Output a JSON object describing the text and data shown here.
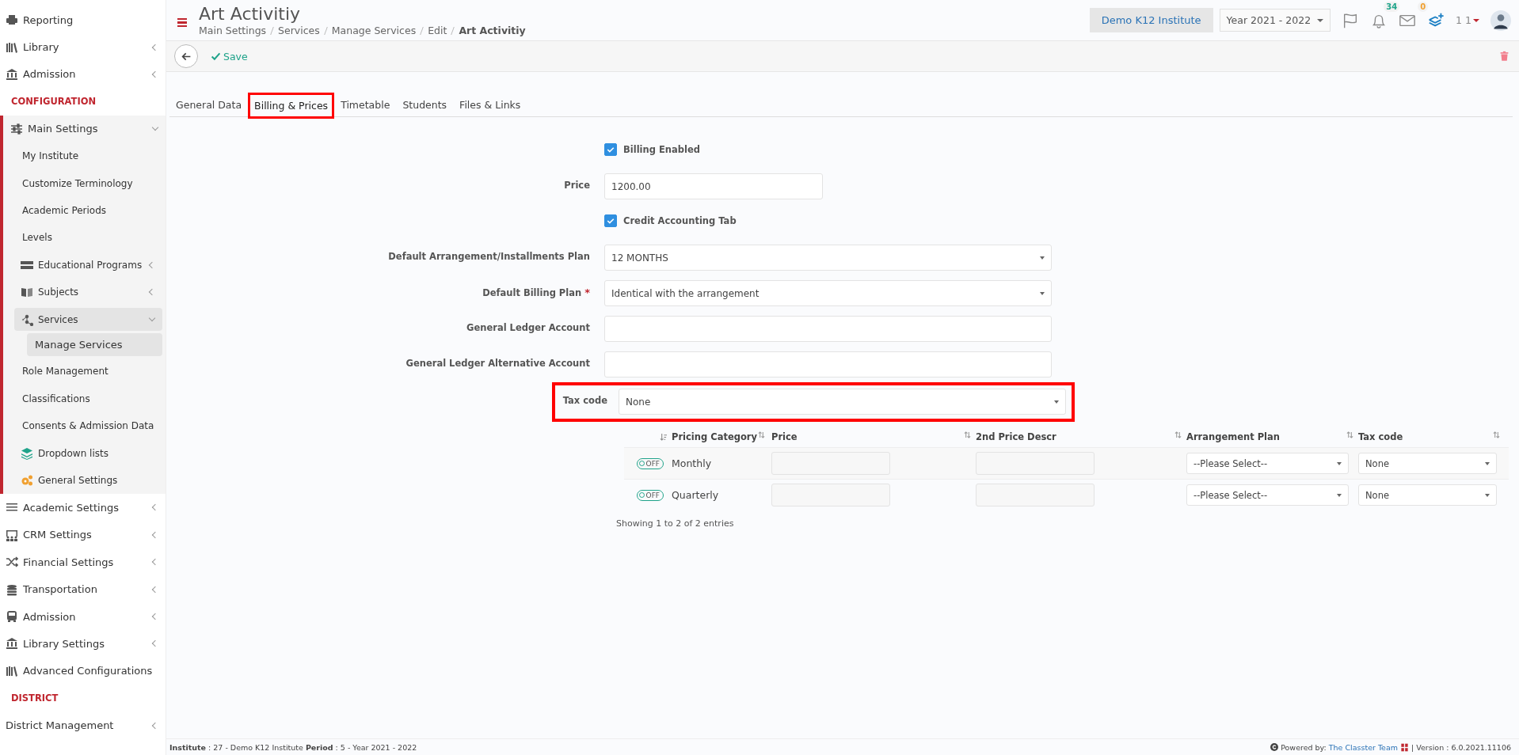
{
  "sidebar": [
    {
      "kind": "item",
      "label": "Reporting"
    },
    {
      "kind": "item",
      "label": "Library",
      "expanded": false
    },
    {
      "kind": "item",
      "label": "Admission",
      "expanded": false
    },
    {
      "kind": "section",
      "label": "CONFIGURATION"
    },
    {
      "kind": "item",
      "label": "Main Settings",
      "expanded": true,
      "children": [
        {
          "label": "My Institute",
          "selected": false
        },
        {
          "label": "Customize Terminology",
          "selected": false
        },
        {
          "label": "Academic Periods",
          "selected": false
        },
        {
          "label": "Levels",
          "selected": false
        },
        {
          "label": "Educational Programs",
          "expanded": false,
          "selected": false
        },
        {
          "label": "Subjects",
          "expanded": false,
          "selected": false
        },
        {
          "label": "Services",
          "expanded": true,
          "selected": true,
          "children": [
            {
              "label": "Manage Services",
              "selected": true
            }
          ]
        },
        {
          "label": "Role Management",
          "selected": false
        },
        {
          "label": "Classifications",
          "selected": false
        },
        {
          "label": "Consents & Admission Data",
          "selected": false
        },
        {
          "label": "Dropdown lists",
          "selected": false
        },
        {
          "label": "General Settings",
          "selected": false
        }
      ]
    },
    {
      "kind": "item",
      "label": "Academic Settings",
      "expanded": false
    },
    {
      "kind": "item",
      "label": "CRM Settings",
      "expanded": false
    },
    {
      "kind": "item",
      "label": "Financial Settings",
      "expanded": false
    },
    {
      "kind": "item",
      "label": "Transportation",
      "expanded": false
    },
    {
      "kind": "item",
      "label": "Admission",
      "expanded": false
    },
    {
      "kind": "item",
      "label": "Library Settings",
      "expanded": false
    },
    {
      "kind": "item",
      "label": "Advanced Configurations"
    },
    {
      "kind": "section",
      "label": "DISTRICT"
    },
    {
      "kind": "item",
      "label": "District Management",
      "expanded": false
    }
  ],
  "header": {
    "title": "Art Activitiy",
    "breadcrumb": [
      "Main Settings",
      "Services",
      "Manage Services",
      "Edit",
      "Art Activitiy"
    ],
    "institute": "Demo K12 Institute",
    "year": "Year 2021 - 2022",
    "notifications": "34",
    "messages": "0",
    "user": "1 1"
  },
  "toolbar": {
    "save": "Save"
  },
  "tabs": [
    {
      "label": "General Data",
      "selected": false,
      "highlighted": false
    },
    {
      "label": "Billing & Prices",
      "selected": true,
      "highlighted": true
    },
    {
      "label": "Timetable",
      "selected": false,
      "highlighted": false
    },
    {
      "label": "Students",
      "selected": false,
      "highlighted": false
    },
    {
      "label": "Files & Links",
      "selected": false,
      "highlighted": false
    }
  ],
  "form": [
    {
      "kind": "checkbox",
      "label": "Billing Enabled",
      "checked": true
    },
    {
      "kind": "text",
      "label": "Price",
      "value": "1200.00",
      "short": true
    },
    {
      "kind": "checkbox",
      "label": "Credit Accounting Tab",
      "checked": true
    },
    {
      "kind": "select",
      "label": "Default Arrangement/Installments Plan",
      "value": "12 MONTHS"
    },
    {
      "kind": "select",
      "label": "Default Billing Plan",
      "value": "Identical with the arrangement",
      "required_mark": "*"
    },
    {
      "kind": "text",
      "label": "General Ledger Account"
    },
    {
      "kind": "text",
      "label": "General Ledger Alternative Account"
    },
    {
      "kind": "select",
      "label": "Tax code",
      "value": "None",
      "highlighted": true
    }
  ],
  "table": {
    "columns": [
      "Pricing Category",
      "Price",
      "2nd Price Descr",
      "Arrangement Plan",
      "Tax code"
    ],
    "rows": [
      {
        "toggle": "OFF",
        "on": false,
        "category": "Monthly",
        "arrangement": "--Please Select--",
        "tax": "None"
      },
      {
        "toggle": "OFF",
        "on": false,
        "category": "Quarterly",
        "arrangement": "--Please Select--",
        "tax": "None"
      }
    ],
    "info": "Showing 1 to 2 of 2 entries"
  },
  "footer": {
    "info": "**Institute** : 27 - Demo K12 Institute **Period** : 5 - Year 2021 - 2022",
    "powered": "Powered by:",
    "team": "The Classter Team",
    "version": "| Version : 6.0.2021.11106"
  }
}
